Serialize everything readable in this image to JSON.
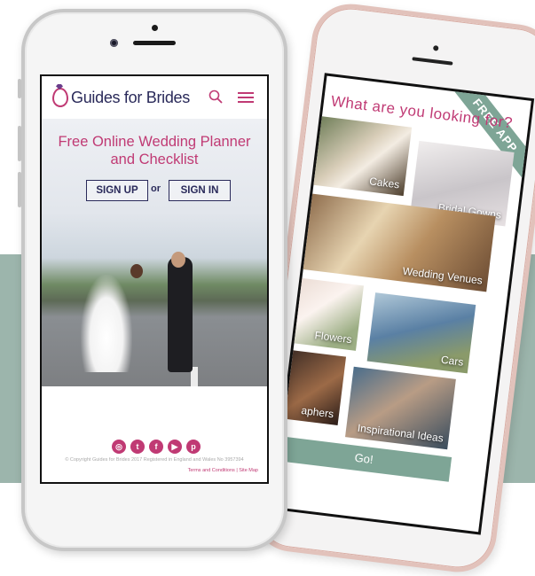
{
  "back_phone": {
    "ribbon": "FREE APP",
    "title": "What are you looking for?",
    "tiles": [
      "Cakes",
      "Bridal Gowns",
      "Wedding Venues",
      "Flowers",
      "Cars",
      "aphers",
      "Inspirational Ideas"
    ],
    "go_label": "Go!"
  },
  "front_phone": {
    "brand": "Guides for Brides",
    "hero_title_line1": "Free Online Wedding Planner",
    "hero_title_line2": "and Checklist",
    "signup_label": "SIGN UP",
    "or_label": "or",
    "signin_label": "SIGN IN",
    "social_icons": [
      "instagram-icon",
      "twitter-icon",
      "facebook-icon",
      "youtube-icon",
      "pinterest-icon"
    ],
    "copyright": "© Copyright Guides for Brides 2017  Registered in England and Wales No 3957394",
    "terms_label": "Terms and Conditions",
    "sitemap_label": "Site Map"
  },
  "colors": {
    "brand_pink": "#c03a74",
    "brand_navy": "#2a2a5a",
    "sage": "#7ea596",
    "band": "#9cb5ac"
  }
}
